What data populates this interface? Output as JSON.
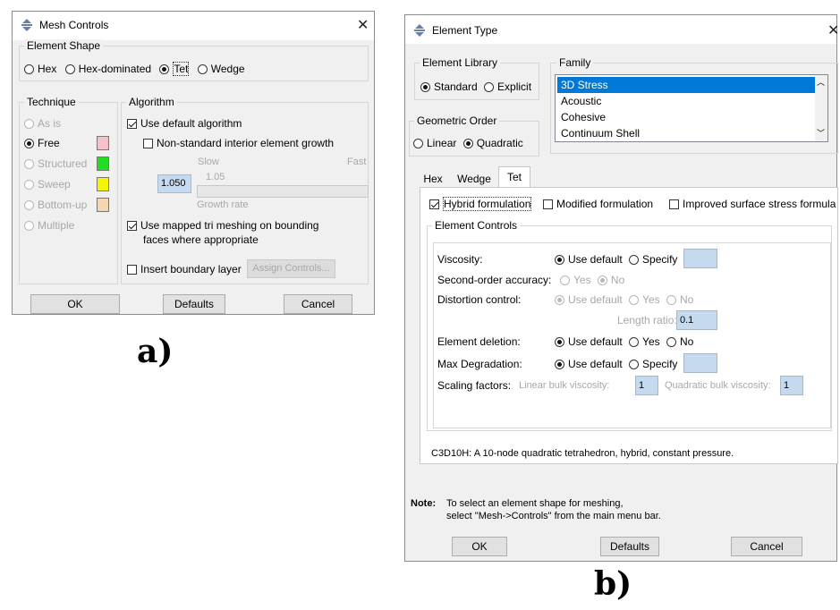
{
  "caption_a": "a)",
  "caption_b": "b)",
  "mesh": {
    "title": "Mesh Controls",
    "element_shape": {
      "legend": "Element Shape",
      "options": [
        "Hex",
        "Hex-dominated",
        "Tet",
        "Wedge"
      ],
      "selected": "Tet"
    },
    "technique": {
      "legend": "Technique",
      "items": [
        "As is",
        "Free",
        "Structured",
        "Sweep",
        "Bottom-up",
        "Multiple"
      ],
      "selected": "Free",
      "swatch_colors": [
        "#f6c1cb",
        "#22dd22",
        "#f5f500",
        "#f6d5b3"
      ]
    },
    "algorithm": {
      "legend": "Algorithm",
      "use_default": "Use default algorithm",
      "non_standard": "Non-standard interior element growth",
      "slow": "Slow",
      "fast": "Fast",
      "growth_value": "1.050",
      "growth_tick": "1.05",
      "growth_rate": "Growth rate",
      "mapped_line1": "Use mapped tri meshing on bounding",
      "mapped_line2": "faces where appropriate",
      "insert_boundary": "Insert boundary layer",
      "assign_controls": "Assign Controls..."
    },
    "buttons": {
      "ok": "OK",
      "defaults": "Defaults",
      "cancel": "Cancel"
    }
  },
  "etype": {
    "title": "Element Type",
    "library": {
      "legend": "Element Library",
      "options": [
        "Standard",
        "Explicit"
      ],
      "selected": "Standard"
    },
    "family": {
      "legend": "Family",
      "items": [
        "3D Stress",
        "Acoustic",
        "Cohesive",
        "Continuum Shell"
      ],
      "selected": "3D Stress"
    },
    "order": {
      "legend": "Geometric Order",
      "options": [
        "Linear",
        "Quadratic"
      ],
      "selected": "Quadratic"
    },
    "tabs": [
      "Hex",
      "Wedge",
      "Tet"
    ],
    "active_tab": "Tet",
    "formulations": [
      "Hybrid formulation",
      "Modified formulation",
      "Improved surface stress formula"
    ],
    "controls": {
      "legend": "Element Controls",
      "viscosity": "Viscosity:",
      "use_default": "Use default",
      "specify": "Specify",
      "second_order": "Second-order accuracy:",
      "yes": "Yes",
      "no": "No",
      "distortion": "Distortion control:",
      "length_ratio": "Length ratio:",
      "length_ratio_value": "0.1",
      "element_deletion": "Element deletion:",
      "max_degradation": "Max Degradation:",
      "scaling": "Scaling factors:",
      "linear_bulk": "Linear bulk viscosity:",
      "linear_bulk_value": "1",
      "quadratic_bulk": "Quadratic bulk viscosity:",
      "quadratic_bulk_value": "1"
    },
    "description": "C3D10H:  A 10-node quadratic tetrahedron, hybrid, constant pressure.",
    "note_label": "Note:",
    "note_line1": "To select an element shape for meshing,",
    "note_line2": "select \"Mesh->Controls\" from the main menu bar.",
    "buttons": {
      "ok": "OK",
      "defaults": "Defaults",
      "cancel": "Cancel"
    }
  }
}
